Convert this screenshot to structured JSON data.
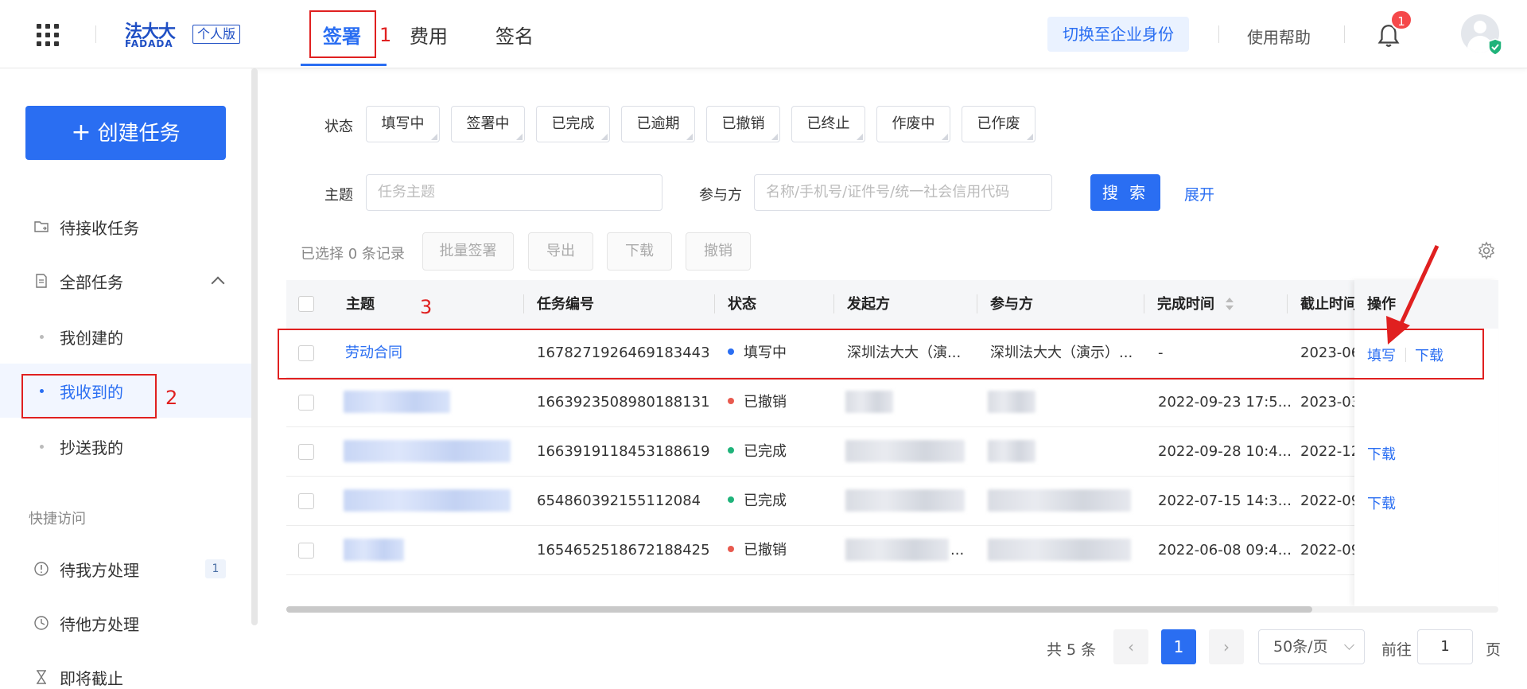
{
  "header": {
    "brand_cn": "法大大",
    "brand_en": "FADADA",
    "brand_badge": "个人版",
    "tabs": [
      {
        "label": "签署"
      },
      {
        "label": "费用"
      },
      {
        "label": "签名"
      }
    ],
    "switch_label": "切换至企业身份",
    "help_label": "使用帮助",
    "notification_count": "1"
  },
  "sidebar": {
    "create_label": "创建任务",
    "pending_label": "待接收任务",
    "all_label": "全部任务",
    "sub_items": [
      {
        "label": "我创建的"
      },
      {
        "label": "我收到的"
      },
      {
        "label": "抄送我的"
      }
    ],
    "quick_title": "快捷访问",
    "quick_items": [
      {
        "label": "待我方处理",
        "count": "1"
      },
      {
        "label": "待他方处理"
      },
      {
        "label": "即将截止"
      }
    ]
  },
  "filters": {
    "status_label": "状态",
    "statuses": [
      "填写中",
      "签署中",
      "已完成",
      "已逾期",
      "已撤销",
      "已终止",
      "作废中",
      "已作废"
    ],
    "subject_label": "主题",
    "subject_placeholder": "任务主题",
    "party_label": "参与方",
    "party_placeholder": "名称/手机号/证件号/统一社会信用代码",
    "search_label": "搜 索",
    "expand_label": "展开"
  },
  "toolbar": {
    "selected_text": "已选择 0 条记录",
    "buttons": [
      "批量签署",
      "导出",
      "下载",
      "撤销"
    ]
  },
  "table": {
    "columns": [
      "主题",
      "任务编号",
      "状态",
      "发起方",
      "参与方",
      "完成时间",
      "截止时间",
      "操作"
    ],
    "rows": [
      {
        "subject": "劳动合同",
        "id": "1678271926469183443",
        "status": "填写中",
        "initiator": "深圳法大大（演...",
        "party": "深圳法大大（演示）...",
        "done": "-",
        "deadline": "2023-06-",
        "ops": [
          "填写",
          "下载"
        ]
      },
      {
        "subject": "",
        "id": "1663923508980188131",
        "status": "已撤销",
        "initiator": "",
        "party": "",
        "done": "2022-09-23 17:5...",
        "deadline": "2023-03-",
        "ops": []
      },
      {
        "subject": "",
        "id": "1663919118453188619",
        "status": "已完成",
        "initiator": "",
        "party": "",
        "done": "2022-09-28 10:4...",
        "deadline": "2022-12-",
        "ops": [
          "下载"
        ]
      },
      {
        "subject": "",
        "id": "654860392155112084",
        "status": "已完成",
        "initiator": "",
        "party": "",
        "done": "2022-07-15 14:3...",
        "deadline": "2022-09-",
        "ops": [
          "下载"
        ]
      },
      {
        "subject": "",
        "id": "1654652518672188425",
        "status": "已撤销",
        "initiator": "...",
        "party": "",
        "done": "2022-06-08 09:4...",
        "deadline": "2022-09-",
        "ops": []
      }
    ]
  },
  "pagination": {
    "total_text": "共 5 条",
    "current_page": "1",
    "page_size": "50条/页",
    "goto_prefix": "前往",
    "goto_value": "1",
    "goto_suffix": "页"
  },
  "annotations": [
    "1",
    "2",
    "3"
  ],
  "colors": {
    "primary": "#2a6ef2",
    "status_filling": "#2a6ef2",
    "status_revoked": "#e85a4f",
    "status_done": "#1fb37a",
    "annotation": "#e02020"
  }
}
